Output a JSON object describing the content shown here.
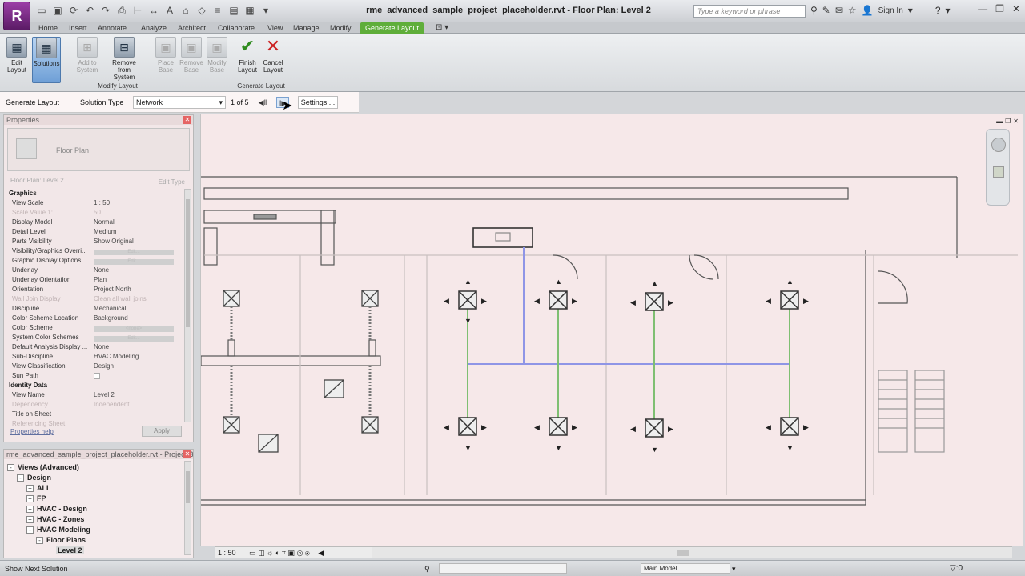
{
  "app": {
    "logo_letter": "R",
    "title": "rme_advanced_sample_project_placeholder.rvt - Floor Plan: Level 2",
    "search_placeholder": "Type a keyword or phrase",
    "sign_in": "Sign In"
  },
  "ribbon_tabs": [
    {
      "label": "Home"
    },
    {
      "label": "Insert"
    },
    {
      "label": "Annotate"
    },
    {
      "label": "Analyze"
    },
    {
      "label": "Architect"
    },
    {
      "label": "Collaborate"
    },
    {
      "label": "View"
    },
    {
      "label": "Manage"
    },
    {
      "label": "Modify"
    },
    {
      "label": "Generate Layout"
    }
  ],
  "ribbon": {
    "edit_layout": "Edit Layout",
    "solutions": "Solutions",
    "add_to_system": "Add to System",
    "remove_from_system": "Remove from System",
    "place_base": "Place Base",
    "remove_base": "Remove Base",
    "modify_base": "Modify Base",
    "finish_layout": "Finish Layout",
    "cancel_layout": "Cancel Layout",
    "panel_modify": "Modify Layout",
    "panel_generate": "Generate Layout"
  },
  "optionbar": {
    "context": "Generate Layout",
    "solution_type_label": "Solution Type",
    "solution_type_value": "Network",
    "counter": "1 of 5",
    "settings": "Settings ..."
  },
  "properties": {
    "title": "Properties",
    "type_name": "Floor Plan",
    "instance_label": "Floor Plan: Level 2",
    "edit_type": "Edit Type",
    "rows": [
      {
        "k": "Graphics",
        "v": "",
        "group": true
      },
      {
        "k": "View Scale",
        "v": "1 : 50"
      },
      {
        "k": "Scale Value 1:",
        "v": "50",
        "dim": true
      },
      {
        "k": "Display Model",
        "v": "Normal"
      },
      {
        "k": "Detail Level",
        "v": "Medium"
      },
      {
        "k": "Parts Visibility",
        "v": "Show Original"
      },
      {
        "k": "Visibility/Graphics Overri...",
        "v": "Edit...",
        "bar": true
      },
      {
        "k": "Graphic Display Options",
        "v": "Edit...",
        "bar": true
      },
      {
        "k": "Underlay",
        "v": "None"
      },
      {
        "k": "Underlay Orientation",
        "v": "Plan"
      },
      {
        "k": "Orientation",
        "v": "Project North"
      },
      {
        "k": "Wall Join Display",
        "v": "Clean all wall joins",
        "dim": true
      },
      {
        "k": "Discipline",
        "v": "Mechanical"
      },
      {
        "k": "Color Scheme Location",
        "v": "Background"
      },
      {
        "k": "Color Scheme",
        "v": "<none>",
        "bar": true
      },
      {
        "k": "System Color Schemes",
        "v": "Edit...",
        "bar": true
      },
      {
        "k": "Default Analysis Display ...",
        "v": "None"
      },
      {
        "k": "Sub-Discipline",
        "v": "HVAC Modeling"
      },
      {
        "k": "View Classification",
        "v": "Design"
      },
      {
        "k": "Sun Path",
        "v": "",
        "check": true
      },
      {
        "k": "Identity Data",
        "v": "",
        "group": true
      },
      {
        "k": "View Name",
        "v": "Level 2"
      },
      {
        "k": "Dependency",
        "v": "Independent",
        "dim": true
      },
      {
        "k": "Title on Sheet",
        "v": ""
      },
      {
        "k": "Referencing Sheet",
        "v": "",
        "dim": true
      }
    ],
    "help_link": "Properties help",
    "apply": "Apply"
  },
  "browser": {
    "title": "rme_advanced_sample_project_placeholder.rvt - Project Browser",
    "items": [
      {
        "label": "Views (Advanced)",
        "indent": 0,
        "pm": "-"
      },
      {
        "label": "Design",
        "indent": 1,
        "pm": "-"
      },
      {
        "label": "ALL",
        "indent": 2,
        "pm": "+"
      },
      {
        "label": "FP",
        "indent": 2,
        "pm": "+"
      },
      {
        "label": "HVAC - Design",
        "indent": 2,
        "pm": "+"
      },
      {
        "label": "HVAC - Zones",
        "indent": 2,
        "pm": "+"
      },
      {
        "label": "HVAC Modeling",
        "indent": 2,
        "pm": "-"
      },
      {
        "label": "Floor Plans",
        "indent": 3,
        "pm": "-"
      },
      {
        "label": "Level 2",
        "indent": 4,
        "pm": "",
        "selected": true
      }
    ]
  },
  "viewbar": {
    "scale": "1 : 50"
  },
  "status": {
    "message": "Show Next Solution",
    "model": "Main Model",
    "filter_count": ":0"
  }
}
